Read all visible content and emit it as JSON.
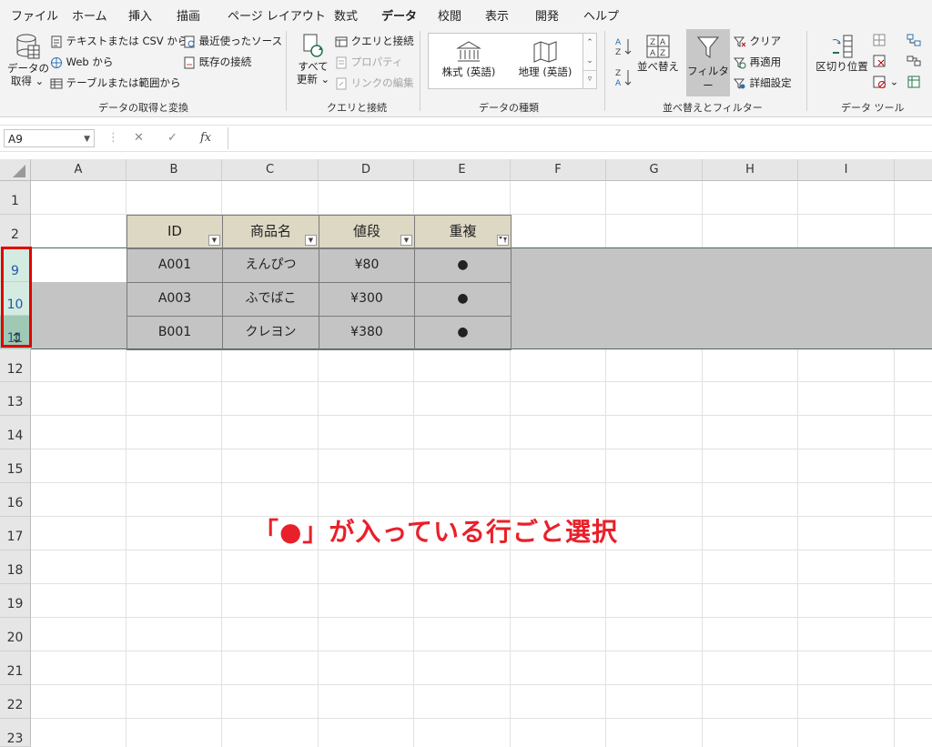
{
  "menu": {
    "tabs": [
      "ファイル",
      "ホーム",
      "挿入",
      "描画",
      "ページ レイアウト",
      "数式",
      "データ",
      "校閲",
      "表示",
      "開発",
      "ヘルプ"
    ],
    "active_tab": "データ"
  },
  "ribbon": {
    "get_data": {
      "get_data_label": "データの",
      "get_data_label2": "取得",
      "from_text_csv": "テキストまたは CSV から",
      "from_web": "Web から",
      "from_table": "テーブルまたは範囲から",
      "recent_sources": "最近使ったソース",
      "existing_connections": "既存の接続",
      "group_label": "データの取得と変換"
    },
    "queries": {
      "refresh_all_line1": "すべて",
      "refresh_all_line2": "更新",
      "queries_connections": "クエリと接続",
      "properties": "プロパティ",
      "edit_links": "リンクの編集",
      "group_label": "クエリと接続"
    },
    "data_types": {
      "stocks": "株式 (英語)",
      "geography": "地理 (英語)",
      "group_label": "データの種類"
    },
    "sort_filter": {
      "sort": "並べ替え",
      "filter": "フィルター",
      "clear": "クリア",
      "reapply": "再適用",
      "advanced": "詳細設定",
      "group_label": "並べ替えとフィルター"
    },
    "data_tools": {
      "text_to_columns": "区切り位置",
      "group_label": "データ ツール"
    }
  },
  "formula_bar": {
    "name_box": "A9",
    "fx": "fx",
    "formula": ""
  },
  "sheet": {
    "columns": [
      "A",
      "B",
      "C",
      "D",
      "E",
      "F",
      "G",
      "H",
      "I"
    ],
    "rows": [
      "1",
      "2",
      "9",
      "10",
      "11",
      "12",
      "13",
      "14",
      "15",
      "16",
      "17",
      "18",
      "19",
      "20",
      "21",
      "22",
      "23"
    ],
    "table_headers": [
      "ID",
      "商品名",
      "値段",
      "重複"
    ],
    "table_rows": [
      [
        "A001",
        "えんぴつ",
        "¥80",
        "●"
      ],
      [
        "A003",
        "ふでばこ",
        "¥300",
        "●"
      ],
      [
        "B001",
        "クレヨン",
        "¥380",
        "●"
      ]
    ]
  },
  "annotation": "「●」が入っている行ごと選択"
}
